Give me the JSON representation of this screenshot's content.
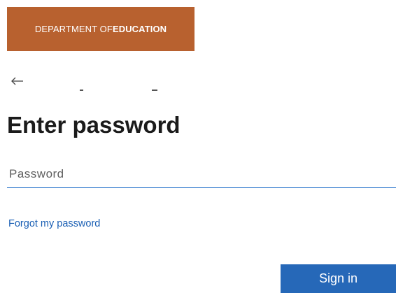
{
  "branding": {
    "org_prefix": "DEPARTMENT OF ",
    "org_emphasis": "EDUCATION",
    "banner_color": "#b8612f"
  },
  "navigation": {
    "back_icon": "left-arrow-icon"
  },
  "form": {
    "title": "Enter password",
    "password_placeholder": "Password",
    "password_value": "",
    "forgot_link": "Forgot my password",
    "submit_label": "Sign in",
    "accent_color": "#2668b8"
  }
}
